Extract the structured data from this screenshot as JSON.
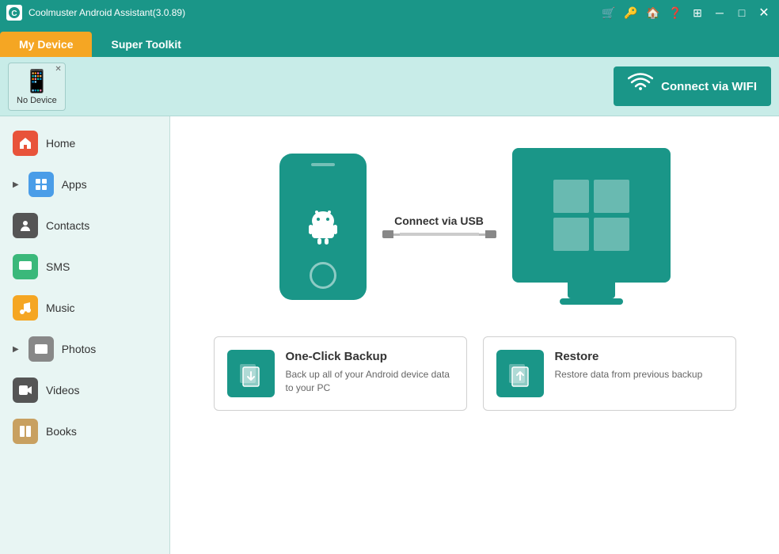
{
  "app": {
    "title": "Coolmuster Android Assistant(3.0.89)"
  },
  "titlebar": {
    "icons": [
      "cart",
      "key",
      "home",
      "question",
      "grid",
      "minimize",
      "maximize",
      "close"
    ]
  },
  "tabs": [
    {
      "id": "my-device",
      "label": "My Device",
      "active": true
    },
    {
      "id": "super-toolkit",
      "label": "Super Toolkit",
      "active": false
    }
  ],
  "device_header": {
    "device_label": "No Device",
    "wifi_button_label": "Connect via WIFI"
  },
  "sidebar": {
    "items": [
      {
        "id": "home",
        "label": "Home",
        "icon": "🏠",
        "has_arrow": false
      },
      {
        "id": "apps",
        "label": "Apps",
        "icon": "📱",
        "has_arrow": true
      },
      {
        "id": "contacts",
        "label": "Contacts",
        "icon": "📋",
        "has_arrow": false
      },
      {
        "id": "sms",
        "label": "SMS",
        "icon": "💬",
        "has_arrow": false
      },
      {
        "id": "music",
        "label": "Music",
        "icon": "🎵",
        "has_arrow": false
      },
      {
        "id": "photos",
        "label": "Photos",
        "icon": "🖼",
        "has_arrow": true
      },
      {
        "id": "videos",
        "label": "Videos",
        "icon": "🎬",
        "has_arrow": false
      },
      {
        "id": "books",
        "label": "Books",
        "icon": "📚",
        "has_arrow": false
      }
    ]
  },
  "content": {
    "usb_label": "Connect via USB",
    "backup_card": {
      "title": "One-Click Backup",
      "description": "Back up all of your Android device data to your PC",
      "icon": "💾"
    },
    "restore_card": {
      "title": "Restore",
      "description": "Restore data from previous backup",
      "icon": "🔄"
    }
  }
}
